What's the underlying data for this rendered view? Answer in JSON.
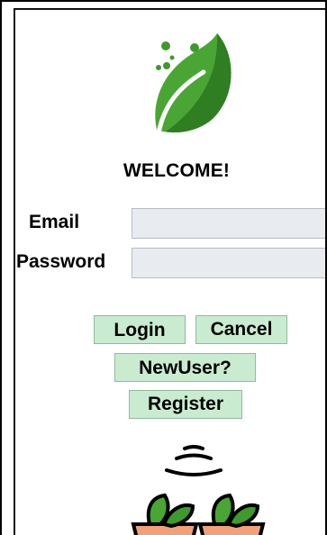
{
  "welcome_text": "WELCOME!",
  "form": {
    "email_label": "Email",
    "email_value": "",
    "password_label": "Password",
    "password_value": ""
  },
  "buttons": {
    "login": "Login",
    "cancel": "Cancel",
    "new_user": "NewUser?",
    "register": "Register"
  },
  "icons": {
    "logo": "leaf-logo-icon",
    "signal": "wireless-signal-icon",
    "plants": "plant-pots-icon"
  },
  "colors": {
    "button_bg": "#c9ecd1",
    "input_bg": "#e8ebef",
    "leaf_green": "#3f9a2e"
  }
}
